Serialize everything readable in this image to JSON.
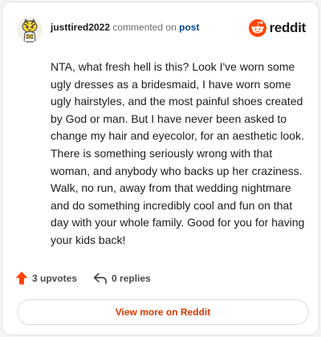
{
  "comment": {
    "username": "justtired2022",
    "action_text": "commented on",
    "post_link_label": "post",
    "body": "NTA, what fresh hell is this? Look I've worn some ugly dresses as a bridesmaid, I have worn some ugly hairstyles, and the most painful shoes created by God or man. But I have never been asked to change my hair and eyecolor, for an aesthetic look. There is something seriously wrong with that woman, and anybody who backs up her craziness. Walk, no run, away from that wedding nightmare and do something incredibly cool and fun on that day with your whole family. Good for you for having your kids back!"
  },
  "brand": {
    "wordmark": "reddit",
    "icon": "reddit-snoo-icon",
    "color": "#ff4500"
  },
  "stats": {
    "upvotes_label": "3 upvotes",
    "upvote_icon": "upvote-arrow-icon",
    "upvote_color": "#ff4500",
    "replies_label": "0 replies",
    "reply_icon": "reply-arrow-icon"
  },
  "cta": {
    "label": "View more on Reddit",
    "color": "#d93a00"
  },
  "avatar": {
    "icon": "snoo-avatar-icon"
  }
}
